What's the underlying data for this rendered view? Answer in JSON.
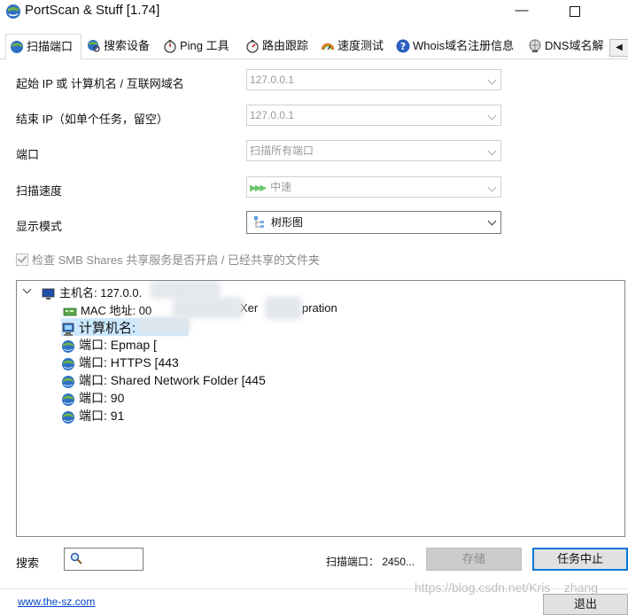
{
  "window": {
    "title": "PortScan & Stuff [1.74]"
  },
  "tabs": [
    {
      "label": "扫描端口",
      "icon": "globe-scan-icon"
    },
    {
      "label": "搜索设备",
      "icon": "globe-search-icon"
    },
    {
      "label": "Ping 工具",
      "icon": "stopwatch-icon"
    },
    {
      "label": "路由跟踪",
      "icon": "stopwatch-route-icon"
    },
    {
      "label": "速度测试",
      "icon": "speedometer-icon"
    },
    {
      "label": "Whois域名注册信息",
      "icon": "help-circle-icon"
    },
    {
      "label": "DNS域名解",
      "icon": "dns-globe-icon"
    }
  ],
  "form": {
    "start_ip_label": "起始 IP 或 计算机名 / 互联网域名",
    "start_ip_value": "127.0.0.1",
    "end_ip_label": "结束 IP（如单个任务，留空）",
    "end_ip_value": "127.0.0.1",
    "port_label": "端口",
    "port_value": "扫描所有端口",
    "speed_label": "扫描速度",
    "speed_value": "中速",
    "display_label": "显示模式",
    "display_value": "树形图",
    "smb_label": "检查 SMB Shares 共享服务是否开启 / 已经共享的文件夹"
  },
  "tree": {
    "host": "主机名: 127.0.0.",
    "mac": "MAC 地址: 00",
    "mac_tail": "Xer",
    "mac_tail2": "pration",
    "computer": "计算机名:",
    "ports": [
      "端口: Epmap [",
      "端口: HTTPS [443",
      "端口: Shared Network Folder [445",
      "端口: 90",
      "端口: 91"
    ]
  },
  "bottom": {
    "search_label": "搜索",
    "status": "扫描端口：  2450...",
    "save_label": "存储",
    "stop_label": "任务中止",
    "link": "www.the-sz.com",
    "exit_label": "退出",
    "watermark": "https://blog.csdn.net/Kris__zhang"
  }
}
